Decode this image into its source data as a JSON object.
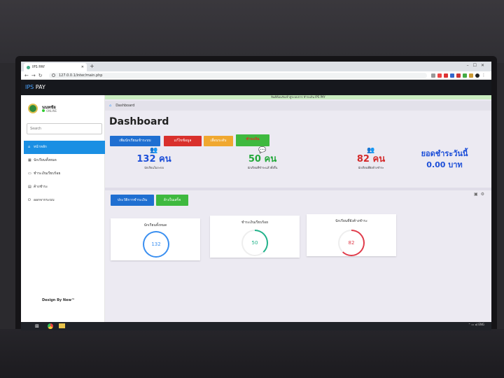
{
  "browser": {
    "tab_title": "IPS PAY",
    "url": "127.0.0.1/inter/main.php"
  },
  "app": {
    "brand_prefix": "IPS",
    "brand_suffix": " PAY"
  },
  "sidebar": {
    "username": "นนทชัย",
    "status": "ONLINE",
    "search_placeholder": "Search",
    "items": [
      {
        "label": "หน้าหลัก",
        "icon": "home-icon"
      },
      {
        "label": "นักเรียนทั้งหมด",
        "icon": "calendar-icon"
      },
      {
        "label": "ชำระเงินเรียบร้อย",
        "icon": "money-icon"
      },
      {
        "label": "ค้างชำระ",
        "icon": "document-icon"
      },
      {
        "label": "ออกจากระบบ",
        "icon": "power-icon"
      }
    ],
    "credit": "Design By New™"
  },
  "header": {
    "announce": "ยินดีต้อนรับเข้าสู่ระบบการ ชำระเงิน IPS PAY",
    "breadcrumb": "Dashboard",
    "title": "Dashboard"
  },
  "buttons": [
    {
      "label": "เพิ่มนักเรียนเข้าระบบ",
      "color": "#1f6fd1"
    },
    {
      "label": "แก้ไขข้อมูล",
      "color": "#d9302c"
    },
    {
      "label": "เลื่อนระดับ",
      "color": "#f0a830"
    },
    {
      "label": "ชำระเงิน",
      "color": "#3fb93f"
    }
  ],
  "stats": [
    {
      "value": "132 คน",
      "caption": "นักเรียนในระบบ",
      "color": "#1d4fd8"
    },
    {
      "value": "50 คน",
      "caption": "นักเรียนที่ชำระแล้วทั้งสิ้น",
      "color": "#22a83a"
    },
    {
      "value": "82 คน",
      "caption": "นักเรียนที่ยังค้างชำระ",
      "color": "#d42a2a"
    }
  ],
  "today": {
    "label": "ยอดชำระวันนี้",
    "value": "0.00 บาท"
  },
  "panel_buttons": [
    {
      "label": "ประวัติการชำระเงิน",
      "color": "#1f6fd1"
    },
    {
      "label": "ล้างในเสร็จ",
      "color": "#3fb93f"
    }
  ],
  "cards": [
    {
      "title": "นักเรียนทั้งหมด",
      "value": "132",
      "color": "#3a8ff0",
      "fraction": 1.0
    },
    {
      "title": "ชำระเงินเรียบร้อย",
      "value": "50",
      "color": "#21b28a",
      "fraction": 0.38
    },
    {
      "title": "นักเรียนที่ยังค้างชำระ",
      "value": "82",
      "color": "#e03b4a",
      "fraction": 0.62
    }
  ]
}
